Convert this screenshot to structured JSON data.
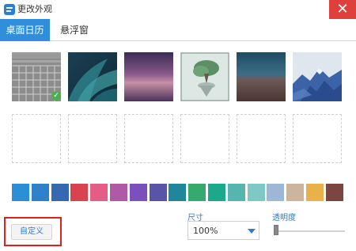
{
  "window": {
    "title": "更改外观",
    "close_label": "✕",
    "app_icon": "app-icon"
  },
  "tabs": [
    {
      "label": "桌面日历",
      "active": true
    },
    {
      "label": "悬浮窗",
      "active": false
    }
  ],
  "wallpapers": [
    {
      "name": "calendar-grid",
      "selected": true
    },
    {
      "name": "teal-leaves",
      "selected": false
    },
    {
      "name": "purple-dusk",
      "selected": false
    },
    {
      "name": "floating-tree",
      "selected": false
    },
    {
      "name": "dark-landscape",
      "selected": false
    },
    {
      "name": "blue-mountains",
      "selected": false
    }
  ],
  "selected_mark": "✓",
  "empty_slots": 6,
  "colors": [
    "#2b8fd6",
    "#2f82c9",
    "#3769b0",
    "#d9434d",
    "#e35d86",
    "#b05aa7",
    "#7b4fbc",
    "#5a54a8",
    "#1f869c",
    "#35a96e",
    "#1ca88a",
    "#56b5ae",
    "#7ec9c5",
    "#9cb8d6",
    "#cdb49c",
    "#e9b14b",
    "#7b4540"
  ],
  "custom_button": {
    "label": "自定义"
  },
  "size": {
    "label": "尺寸",
    "value": "100%"
  },
  "opacity": {
    "label": "透明度",
    "level": 0
  }
}
